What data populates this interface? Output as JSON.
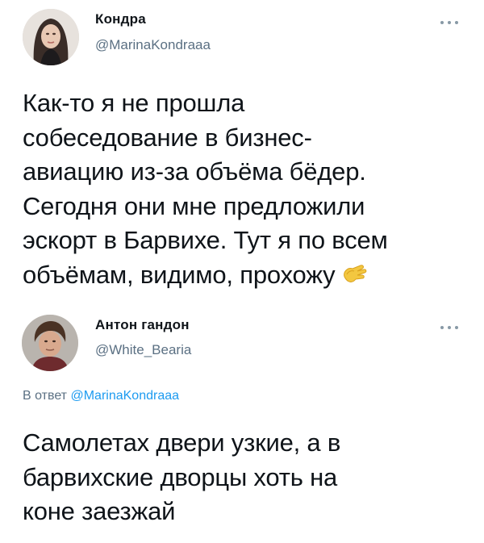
{
  "tweet1": {
    "display_name": "Кондра",
    "handle": "@MarinaKondraaa",
    "text_lines": [
      "Как-то я не прошла",
      "собеседование в бизнес-",
      "авиацию из-за объёма бёдер.",
      "Сегодня они мне предложили",
      "эскорт в Барвихе. Тут я по всем",
      "объёмам, видимо, прохожу"
    ],
    "emoji_icon": "clapping-hands-icon"
  },
  "tweet2": {
    "display_name": "Антон гандон",
    "handle": "@White_Bearia",
    "reply_prefix": "В ответ",
    "reply_mention": "@MarinaKondraaa",
    "text_lines": [
      "Самолетах двери узкие, а в",
      "барвихские дворцы хоть на",
      "коне заезжай"
    ]
  },
  "colors": {
    "text": "#0f1419",
    "secondary": "#5b7083",
    "link": "#1d9bf0"
  }
}
